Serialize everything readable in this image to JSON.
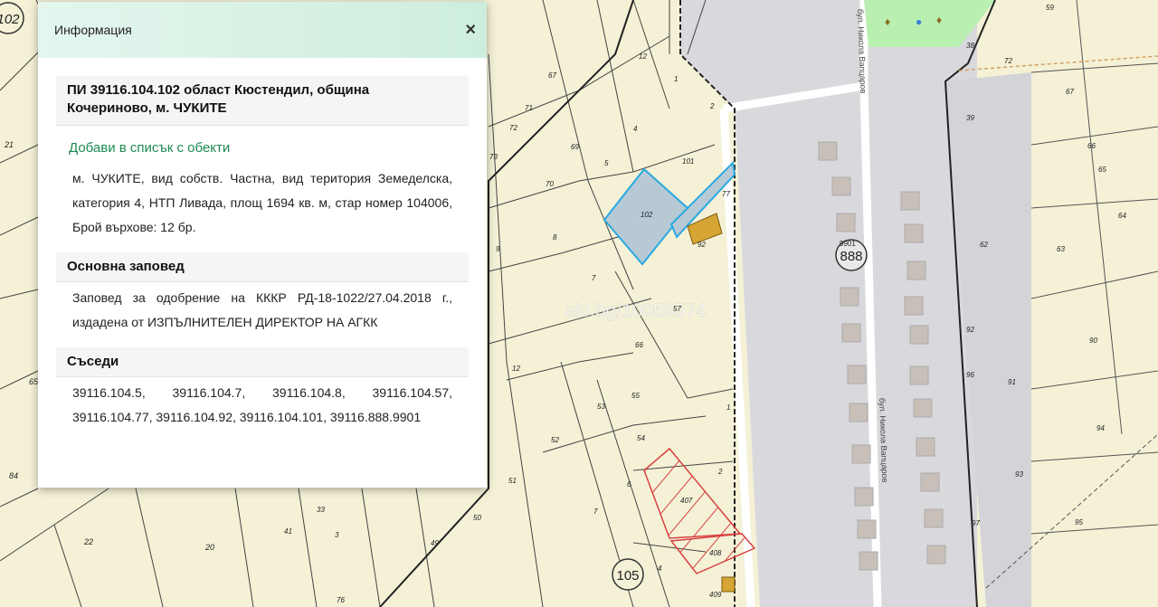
{
  "panel": {
    "title": "Информация",
    "close_label": "×",
    "parcel_heading": "ПИ 39116.104.102 област Кюстендил, община Кочериново, м. ЧУКИТЕ",
    "add_link": "Добави в списък с обекти",
    "description": "м. ЧУКИТЕ, вид собств. Частна, вид територия Земеделска, категория 4, НТП Ливада, площ 1694 кв. м, стар номер 104006, Брой върхове: 12 бр.",
    "order_heading": "Основна заповед",
    "order_text": "Заповед за одобрение на КККР РД-18-1022/27.04.2018 г., издадена от ИЗПЪЛНИТЕЛЕН ДИРЕКТОР НА АГКК",
    "neighbors_heading": "Съседи",
    "neighbors_text": "39116.104.5, 39116.104.7, 39116.104.8, 39116.104.57, 39116.104.77, 39116.104.92, 39116.104.101, 39116.888.9901"
  },
  "map": {
    "watermark": "alo.bg/10056574",
    "street_label_top": "бул. Никола Вапцаров",
    "street_label_bottom": "бул. Никола Вапцаров",
    "block_labels": [
      "102",
      "888",
      "105"
    ],
    "small_label_9901": "9901",
    "left_labels": [
      "21",
      "65",
      "84",
      "22",
      "20"
    ],
    "parcel_labels": [
      "67",
      "71",
      "72",
      "73",
      "70",
      "69",
      "12",
      "1",
      "2",
      "4",
      "5",
      "101",
      "77",
      "102",
      "92",
      "8",
      "9",
      "7",
      "57",
      "66",
      "12",
      "53",
      "55",
      "54",
      "52",
      "51",
      "50",
      "6",
      "7",
      "4",
      "2",
      "407",
      "408",
      "409",
      "3",
      "1",
      "41",
      "76",
      "49",
      "33"
    ],
    "right_labels": [
      "59",
      "38",
      "72",
      "39",
      "67",
      "66",
      "65",
      "64",
      "62",
      "63",
      "92",
      "96",
      "90",
      "91",
      "94",
      "93",
      "97",
      "95"
    ],
    "colors": {
      "selected_fill": "#b8c9d6",
      "selected_stroke": "#29a9e0",
      "road": "#d8d8dc",
      "park": "#b9efb0",
      "building": "#d6a533",
      "hatch": "#d94040"
    }
  }
}
